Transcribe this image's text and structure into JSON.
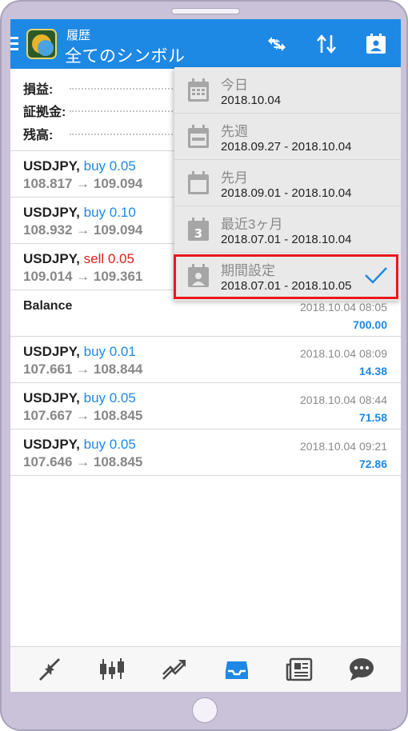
{
  "header": {
    "subtitle": "履歴",
    "title": "全てのシンボル"
  },
  "summary": {
    "profit_label": "損益:",
    "margin_label": "証拠金:",
    "balance_label": "残高:"
  },
  "rows": [
    {
      "symbol": "USDJPY,",
      "side": "buy 0.05",
      "side_type": "buy",
      "prices": "108.817 → 109.094",
      "date": "",
      "amount": ""
    },
    {
      "symbol": "USDJPY,",
      "side": "buy 0.10",
      "side_type": "buy",
      "prices": "108.932 → 109.094",
      "date": "",
      "amount": ""
    },
    {
      "symbol": "USDJPY,",
      "side": "sell 0.05",
      "side_type": "sell",
      "prices": "109.014 → 109.361",
      "date": "",
      "amount": ""
    },
    {
      "symbol": "Balance",
      "side": "",
      "side_type": "",
      "prices": "",
      "date": "2018.10.04 08:05",
      "amount": "700.00"
    },
    {
      "symbol": "USDJPY,",
      "side": "buy 0.01",
      "side_type": "buy",
      "prices": "107.661 → 108.844",
      "date": "2018.10.04 08:09",
      "amount": "14.38"
    },
    {
      "symbol": "USDJPY,",
      "side": "buy 0.05",
      "side_type": "buy",
      "prices": "107.667 → 108.845",
      "date": "2018.10.04 08:44",
      "amount": "71.58"
    },
    {
      "symbol": "USDJPY,",
      "side": "buy 0.05",
      "side_type": "buy",
      "prices": "107.646 → 108.845",
      "date": "2018.10.04 09:21",
      "amount": "72.86"
    }
  ],
  "dropdown": {
    "items": [
      {
        "label": "今日",
        "range": "2018.10.04",
        "icon": "calendar-icon"
      },
      {
        "label": "先週",
        "range": "2018.09.27 - 2018.10.04",
        "icon": "calendar-week-icon"
      },
      {
        "label": "先月",
        "range": "2018.09.01 - 2018.10.04",
        "icon": "calendar-month-icon"
      },
      {
        "label": "最近3ヶ月",
        "range": "2018.07.01 - 2018.10.04",
        "icon": "calendar-3-icon",
        "badge": "3"
      },
      {
        "label": "期間設定",
        "range": "2018.07.01 - 2018.10.05",
        "icon": "calendar-person-icon",
        "selected": true
      }
    ]
  },
  "colors": {
    "appbar": "#1e88e5",
    "buy": "#1e88e5",
    "sell": "#e02020",
    "highlight": "#e8191e"
  },
  "nav": [
    "quotes-icon",
    "chart-icon",
    "trade-icon",
    "history-icon",
    "news-icon",
    "chat-icon"
  ]
}
